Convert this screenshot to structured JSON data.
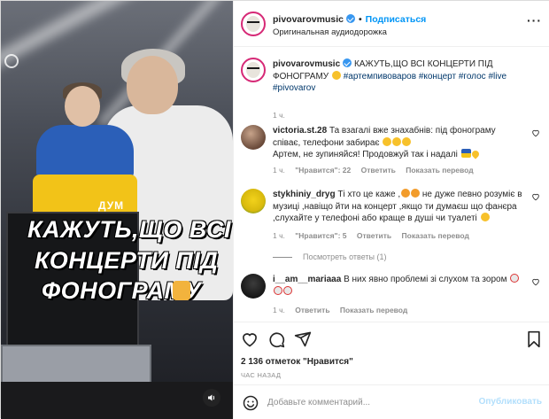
{
  "media": {
    "brand": "ДУМ",
    "caption_lines": [
      "КАЖУТЬ,ЩО ВСІ",
      "КОНЦЕРТИ ПІД",
      "ФОНОГРАМУ"
    ]
  },
  "header": {
    "username": "pivovarovmusic",
    "separator": "•",
    "follow_label": "Подписаться",
    "audio_label": "Оригинальная аудиодорожка",
    "more_icon": "more-horizontal-icon"
  },
  "caption": {
    "username": "pivovarovmusic",
    "text": "КАЖУТЬ,ЩО ВСІ КОНЦЕРТИ ПІД ФОНОГРАМУ",
    "hashtags": "#артемпивоваров #концерт #голос #live #pivovarov",
    "time": "1 ч."
  },
  "comments": [
    {
      "username": "victoria.st.28",
      "text": "Та взагалі вже знахабнів: під фонограму співає, телефони забирає",
      "text2": "Артем, не зупиняйся! Продовжуй так і надалі",
      "time": "1 ч.",
      "likes": "\"Нравится\": 22",
      "reply_label": "Ответить",
      "translate_label": "Показать перевод"
    },
    {
      "username": "stykhiniy_dryg",
      "text": "Ті хто це каже ,",
      "text_b": "не дуже певно розуміє в музиці ,навіщо йти на концерт ,якщо ти думаєш що фанєра ,слухайте у телефоні або краще в душі чи туалеті",
      "time": "1 ч.",
      "likes": "\"Нравится\": 5",
      "reply_label": "Ответить",
      "translate_label": "Показать перевод",
      "view_replies": "Посмотреть ответы (1)"
    },
    {
      "username": "i__am__mariaaa",
      "text": "В них явно проблемі зі слухом та зором",
      "time": "1 ч.",
      "reply_label": "Ответить",
      "translate_label": "Показать перевод"
    }
  ],
  "actions": {
    "like_icon": "heart-icon",
    "comment_icon": "comment-icon",
    "share_icon": "share-icon",
    "save_icon": "bookmark-icon"
  },
  "likes_text": "2 136 отметок \"Нравится\"",
  "time_ago": "ЧАС НАЗАД",
  "add_comment": {
    "placeholder": "Добавьте комментарий...",
    "publish_label": "Опубликовать"
  },
  "colors": {
    "accent": "#0095f6",
    "publish_disabled": "#b2dffc",
    "secondary_text": "#8e8e8e",
    "hashtag": "#00376b"
  }
}
